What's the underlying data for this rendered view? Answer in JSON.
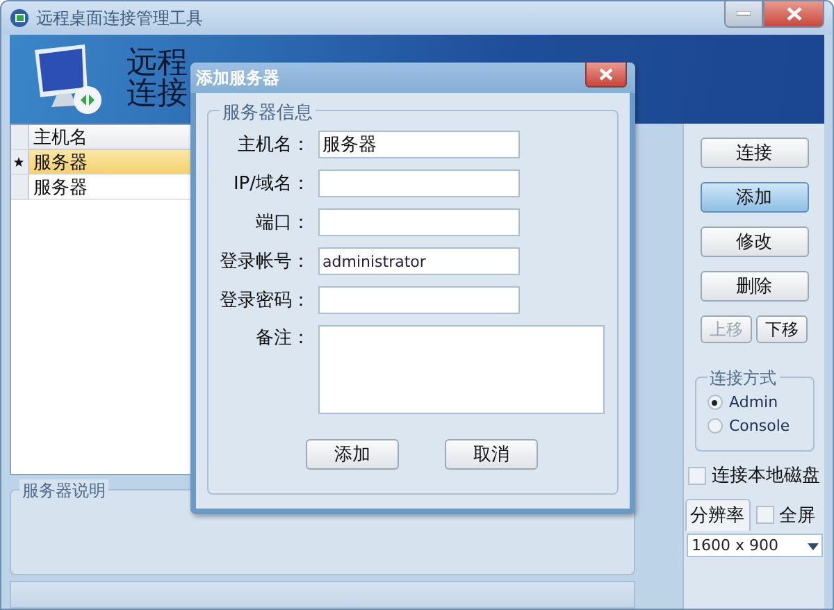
{
  "window": {
    "title": "远程桌面连接管理工具"
  },
  "banner": {
    "title_lines": [
      "远程",
      "连接"
    ]
  },
  "server_list": {
    "columns": [
      "主机名"
    ],
    "rows": [
      {
        "name": "服务器",
        "selected": true
      },
      {
        "name": "服务器",
        "selected": false
      }
    ]
  },
  "description_group": {
    "title": "服务器说明"
  },
  "side_buttons": [
    {
      "label": "连接",
      "focused": false,
      "disabled": false
    },
    {
      "label": "添加",
      "focused": true,
      "disabled": false
    },
    {
      "label": "修改",
      "focused": false,
      "disabled": false
    },
    {
      "label": "删除",
      "focused": false,
      "disabled": false
    }
  ],
  "move_buttons": [
    {
      "label": "上移",
      "disabled": true
    },
    {
      "label": "下移",
      "disabled": false
    }
  ],
  "connect_mode": {
    "title": "连接方式",
    "options": [
      {
        "label": "Admin",
        "selected": true
      },
      {
        "label": "Console",
        "selected": false
      }
    ]
  },
  "local_disk": {
    "label": "连接本地磁盘",
    "checked": false
  },
  "resolution": {
    "tab": "分辨率",
    "fullscreen": {
      "label": "全屏",
      "checked": false
    },
    "value": "1600 x 900"
  },
  "dialog": {
    "title": "添加服务器",
    "group": "服务器信息",
    "fields": [
      {
        "label": "主机名：",
        "kind": "line",
        "value": "服务器"
      },
      {
        "label": "IP/域名：",
        "kind": "line"
      },
      {
        "label": "端口：",
        "kind": "line"
      },
      {
        "label": "登录帐号：",
        "kind": "line",
        "value": "administrator"
      },
      {
        "label": "登录密码：",
        "kind": "line"
      },
      {
        "label": "备注：",
        "kind": "multiline"
      }
    ],
    "buttons": [
      "添加",
      "取消"
    ]
  }
}
